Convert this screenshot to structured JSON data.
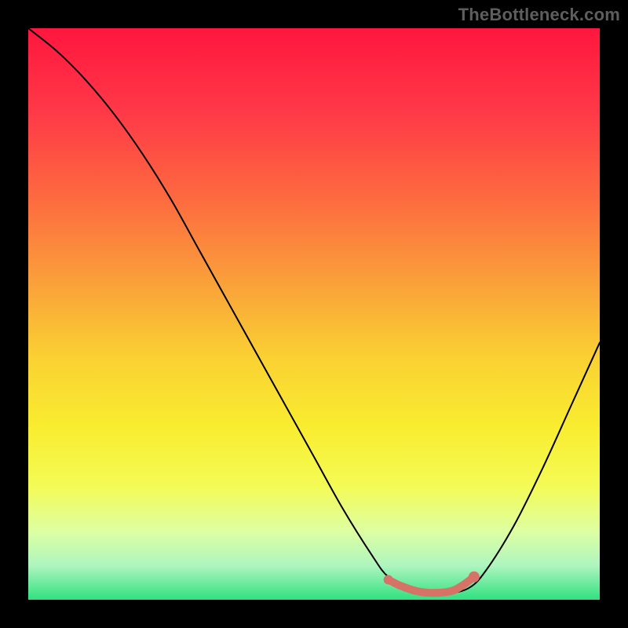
{
  "watermark": "TheBottleneck.com",
  "chart_data": {
    "type": "line",
    "title": "",
    "xlabel": "",
    "ylabel": "",
    "xlim": [
      0,
      100
    ],
    "ylim": [
      0,
      100
    ],
    "grid": false,
    "background_gradient": {
      "stops": [
        {
          "offset": 0,
          "color": "#ff163e"
        },
        {
          "offset": 15,
          "color": "#ff3a48"
        },
        {
          "offset": 30,
          "color": "#fd6b3f"
        },
        {
          "offset": 45,
          "color": "#faa23a"
        },
        {
          "offset": 58,
          "color": "#fad232"
        },
        {
          "offset": 70,
          "color": "#f9ed30"
        },
        {
          "offset": 80,
          "color": "#f4fb55"
        },
        {
          "offset": 88,
          "color": "#deffa2"
        },
        {
          "offset": 94,
          "color": "#aef5bf"
        },
        {
          "offset": 100,
          "color": "#30e180"
        }
      ]
    },
    "series": [
      {
        "name": "curve",
        "color": "#000000",
        "stroke_width": 2,
        "x": [
          0,
          5,
          10,
          15,
          20,
          25,
          30,
          35,
          40,
          45,
          50,
          55,
          60,
          63,
          67,
          70,
          73,
          77,
          80,
          85,
          90,
          95,
          100
        ],
        "y": [
          100,
          96,
          91,
          85,
          78,
          70,
          61,
          52,
          43,
          34,
          25,
          16,
          8,
          4,
          2,
          1,
          1,
          2,
          5,
          13,
          23,
          34,
          45
        ]
      },
      {
        "name": "sweet-spot",
        "color": "#d67366",
        "stroke_width": 10,
        "x": [
          63,
          65,
          68,
          71,
          74,
          76,
          78
        ],
        "y": [
          3.5,
          2.5,
          1.5,
          1.2,
          1.5,
          2.5,
          4.0
        ]
      }
    ],
    "markers": [
      {
        "name": "sweet-spot-start",
        "x": 63,
        "y": 3.5,
        "color": "#d67366",
        "size": 12
      },
      {
        "name": "sweet-spot-end",
        "x": 78,
        "y": 4.0,
        "color": "#d67366",
        "size": 14
      }
    ],
    "legend": null
  }
}
